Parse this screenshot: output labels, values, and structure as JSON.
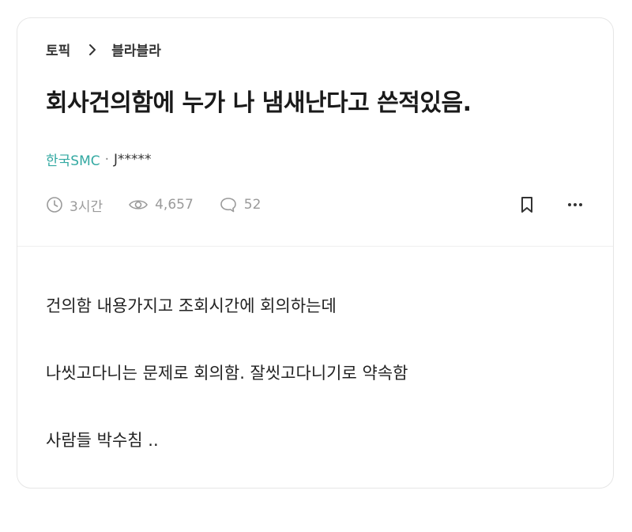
{
  "breadcrumb": {
    "topic": "토픽",
    "board": "블라블라"
  },
  "post": {
    "title": "회사건의함에 누가 나 냄새난다고 쓴적있음.",
    "company": "한국SMC",
    "separator": "·",
    "author": "J*****",
    "time": "3시간",
    "views": "4,657",
    "comments": "52",
    "body": [
      "건의함 내용가지고 조회시간에 회의하는데",
      "나씻고다니는 문제로 회의함. 잘씻고다니기로 약속함",
      "사람들 박수침 .."
    ]
  },
  "icons": {
    "chevron": "chevron-right-icon",
    "clock": "clock-icon",
    "eye": "eye-icon",
    "comment": "comment-bubble-icon",
    "bookmark": "bookmark-icon",
    "more": "more-dots-icon"
  },
  "colors": {
    "company_accent": "#33a9a2",
    "meta_gray": "#9a9a9a",
    "title_text": "#1a1a1a"
  }
}
